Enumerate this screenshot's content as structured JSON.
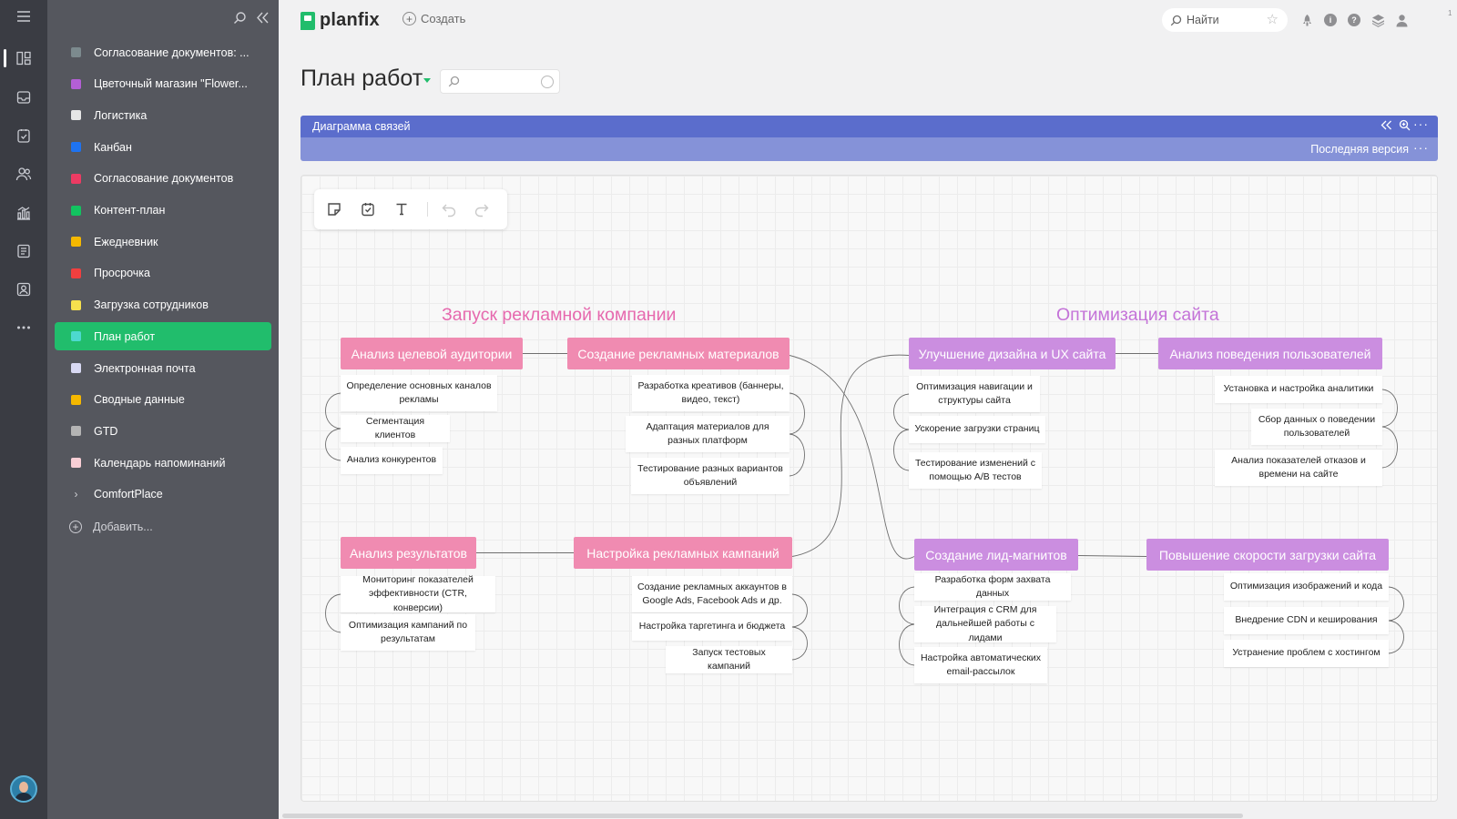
{
  "rail": {
    "icons": [
      "menu-icon",
      "board-icon",
      "inbox-icon",
      "tasks-icon",
      "contacts-icon",
      "reports-icon",
      "documents-icon",
      "profile-card-icon",
      "more-icon"
    ]
  },
  "projects": {
    "items": [
      {
        "label": "Согласование документов: ...",
        "color": "#7c8a8e"
      },
      {
        "label": "Цветочный магазин \"Flower...",
        "color": "#b45fd6"
      },
      {
        "label": "Логистика",
        "color": "#e6e6e6"
      },
      {
        "label": "Канбан",
        "color": "#1e73f0"
      },
      {
        "label": "Согласование документов",
        "color": "#ec3b63"
      },
      {
        "label": "Контент-план",
        "color": "#12c460"
      },
      {
        "label": "Ежедневник",
        "color": "#f5b800"
      },
      {
        "label": "Просрочка",
        "color": "#f13f3f"
      },
      {
        "label": "Загрузка сотрудников",
        "color": "#f6e04e"
      },
      {
        "label": "План работ",
        "color": "#4dd9cf",
        "active": true
      },
      {
        "label": "Электронная почта",
        "color": "#d8d9f3"
      },
      {
        "label": "Сводные данные",
        "color": "#f5b800"
      },
      {
        "label": "GTD",
        "color": "#b4b4b4"
      },
      {
        "label": "Календарь напоминаний",
        "color": "#f9cfd6"
      }
    ],
    "group": "ComfortPlace",
    "add_label": "Добавить..."
  },
  "topbar": {
    "logo": "planfix",
    "create_label": "Создать",
    "search_placeholder": "Найти",
    "notif_count": "1"
  },
  "page": {
    "title": "План работ"
  },
  "panel": {
    "title": "Диаграмма связей",
    "version_label": "Последняя версия"
  },
  "mindmap": {
    "left_title": "Запуск  рекламной компании",
    "right_title": "Оптимизация сайта",
    "nodes": {
      "n1": "Анализ целевой аудитории",
      "n2": "Создание рекламных материалов",
      "n3": "Анализ результатов",
      "n4": "Настройка рекламных кампаний",
      "n5": "Улучшение дизайна и UX сайта",
      "n6": "Анализ поведения пользователей",
      "n7": "Создание лид-магнитов",
      "n8": "Повышение скорости загрузки сайта"
    },
    "subs": {
      "n1": [
        "Определение основных каналов рекламы",
        "Сегментация клиентов",
        "Анализ конкурентов"
      ],
      "n2": [
        "Разработка креативов (баннеры, видео, текст)",
        "Адаптация материалов для разных платформ",
        "Тестирование разных вариантов объявлений"
      ],
      "n3": [
        "Мониторинг показателей эффективности (CTR, конверсии)",
        "Оптимизация кампаний по результатам"
      ],
      "n4": [
        "Создание рекламных аккаунтов в Google Ads, Facebook Ads и др.",
        "Настройка таргетинга и бюджета",
        "Запуск тестовых кампаний"
      ],
      "n5": [
        "Оптимизация навигации и структуры сайта",
        "Ускорение загрузки страниц",
        "Тестирование изменений с помощью A/B тестов"
      ],
      "n6": [
        "Установка и настройка аналитики",
        "Сбор данных о поведении пользователей",
        "Анализ показателей отказов и времени на сайте"
      ],
      "n7": [
        "Разработка форм захвата данных",
        "Интеграция с CRM для дальнейшей работы с лидами",
        "Настройка автоматических email-рассылок"
      ],
      "n8": [
        "Оптимизация изображений и кода",
        "Внедрение CDN и кеширования",
        "Устранение проблем с хостингом"
      ]
    }
  },
  "colors": {
    "accent_green": "#21bd6c",
    "panel_header": "#5b6dcc",
    "node_pink": "#f08bb1",
    "node_purple": "#cb8ee0"
  }
}
